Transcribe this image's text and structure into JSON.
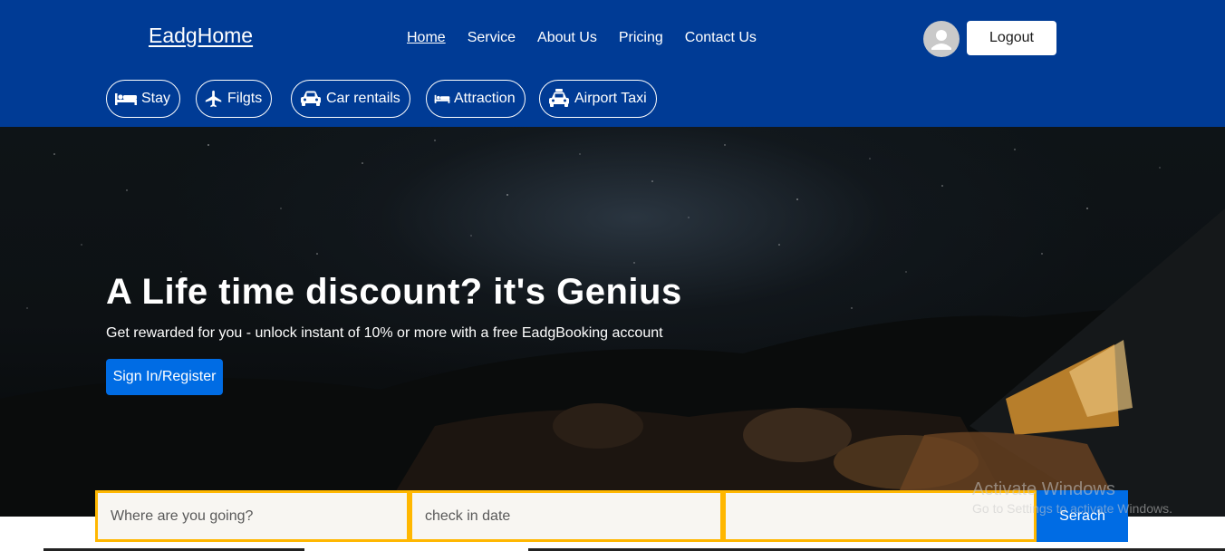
{
  "header": {
    "brand": "EadgHome",
    "nav": [
      {
        "label": "Home"
      },
      {
        "label": "Service"
      },
      {
        "label": "About Us"
      },
      {
        "label": "Pricing"
      },
      {
        "label": "Contact Us"
      }
    ],
    "avatar_icon": "user-avatar-icon",
    "logout_label": "Logout",
    "categories": [
      {
        "label": "Stay",
        "icon": "bed-icon"
      },
      {
        "label": "Filgts",
        "icon": "plane-icon"
      },
      {
        "label": "Car rentails",
        "icon": "car-icon"
      },
      {
        "label": "Attraction",
        "icon": "bed-icon"
      },
      {
        "label": "Airport Taxi",
        "icon": "taxi-icon"
      }
    ],
    "background_color": "#003b95"
  },
  "hero": {
    "title": "A Life time discount? it's Genius",
    "subtitle": "Get rewarded for you - unlock instant of 10% or more with a free EadgBooking account",
    "signin_label": "Sign In/Register",
    "accent_color": "#006ce4"
  },
  "search": {
    "destination_placeholder": "Where are you going?",
    "checkin_placeholder": "check in date",
    "checkout_placeholder": "",
    "search_label": "Serach",
    "border_color": "#ffb700"
  },
  "watermark": {
    "title": "Activate Windows",
    "subtitle": "Go to Settings to activate Windows."
  }
}
